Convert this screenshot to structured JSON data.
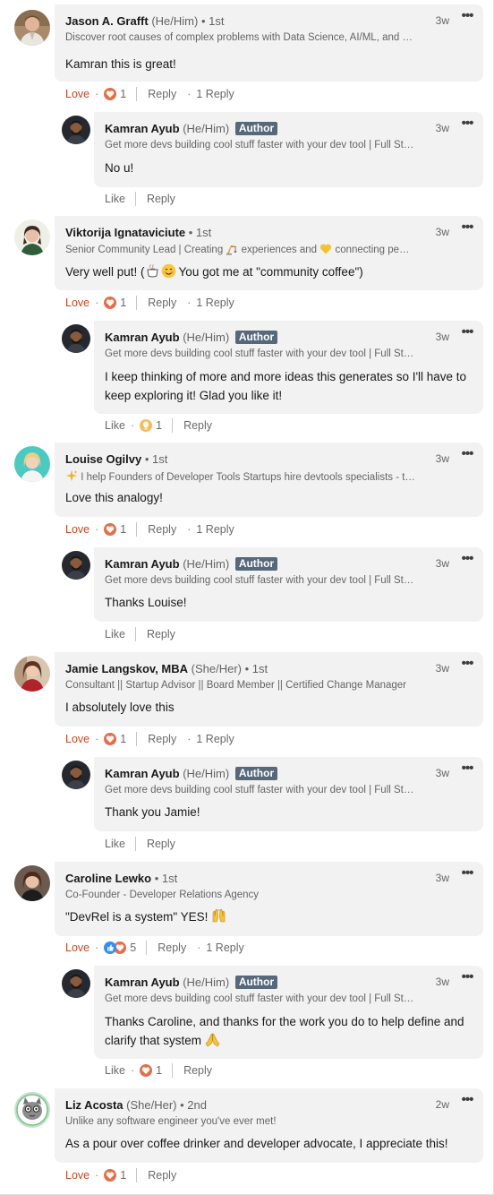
{
  "author_badge": "Author",
  "action_labels": {
    "reply": "Reply",
    "like": "Like"
  },
  "colors": {
    "love": "#c34a27",
    "bubble": "#f2f2f2",
    "badge": "#56687a"
  },
  "comments": [
    {
      "name": "Jason A. Grafft",
      "pronouns": "(He/Him)",
      "degree": "• 1st",
      "headline": "Discover root causes of complex problems with Data Science, AI/ML, and …",
      "time": "3w",
      "text": "Kamran this is great!",
      "reaction_label": "Love",
      "reaction_count": "1",
      "reply_count": "1 Reply",
      "reply": {
        "name": "Kamran Ayub",
        "pronouns": "(He/Him)",
        "headline": "Get more devs building cool stuff faster with your dev tool | Full St…",
        "time": "3w",
        "text": "No u!"
      }
    },
    {
      "name": "Viktorija Ignataviciute",
      "degree": "• 1st",
      "headline_parts": [
        "Senior Community Lead | Creating",
        "experiences and",
        "connecting pe…"
      ],
      "headline_icons": [
        "crane-icon",
        "yellow-heart-icon"
      ],
      "time": "3w",
      "text_parts": [
        "Very well put! (",
        "You got me at \"community coffee\")"
      ],
      "text_icons": [
        "coffee-icon",
        "smiling-face-icon"
      ],
      "reaction_label": "Love",
      "reaction_count": "1",
      "reply_count": "1 Reply",
      "reply": {
        "name": "Kamran Ayub",
        "pronouns": "(He/Him)",
        "headline": "Get more devs building cool stuff faster with your dev tool | Full St…",
        "time": "3w",
        "text": "I keep thinking of more and more ideas this generates so I'll have to keep exploring it! Glad you like it!",
        "reaction_icon": "insightful-icon",
        "reaction_count": "1"
      }
    },
    {
      "name": "Louise Ogilvy",
      "degree": "• 1st",
      "headline": "I help Founders of Developer Tools Startups hire devtools specialists - t…",
      "headline_icon": "sparkle-icon",
      "time": "3w",
      "text": "Love this analogy!",
      "reaction_label": "Love",
      "reaction_count": "1",
      "reply_count": "1 Reply",
      "reply": {
        "name": "Kamran Ayub",
        "pronouns": "(He/Him)",
        "headline": "Get more devs building cool stuff faster with your dev tool | Full St…",
        "time": "3w",
        "text": "Thanks Louise!"
      }
    },
    {
      "name": "Jamie Langskov, MBA",
      "pronouns": "(She/Her)",
      "degree": "• 1st",
      "headline": "Consultant || Startup Advisor || Board Member || Certified Change Manager",
      "time": "3w",
      "text": "I absolutely love this",
      "reaction_label": "Love",
      "reaction_count": "1",
      "reply_count": "1 Reply",
      "reply": {
        "name": "Kamran Ayub",
        "pronouns": "(He/Him)",
        "headline": "Get more devs building cool stuff faster with your dev tool | Full St…",
        "time": "3w",
        "text": "Thank you Jamie!"
      }
    },
    {
      "name": "Caroline Lewko",
      "degree": "• 1st",
      "headline": "Co-Founder - Developer Relations Agency",
      "time": "3w",
      "text": "\"DevRel is a system\" YES!",
      "text_icon": "raising-hands-icon",
      "reaction_label": "Love",
      "reaction_count": "5",
      "reply_count": "1 Reply",
      "reply": {
        "name": "Kamran Ayub",
        "pronouns": "(He/Him)",
        "headline": "Get more devs building cool stuff faster with your dev tool | Full St…",
        "time": "3w",
        "text": "Thanks Caroline, and thanks for the work you do to help define and clarify that system",
        "text_icon": "folded-hands-icon",
        "reaction_icon": "love-icon",
        "reaction_count": "1"
      }
    },
    {
      "name": "Liz Acosta",
      "pronouns": "(She/Her)",
      "degree": "• 2nd",
      "headline": "Unlike any software engineer you've ever met!",
      "time": "2w",
      "text": "As a pour over coffee drinker and developer advocate, I appreciate this!",
      "reaction_label": "Love",
      "reaction_count": "1"
    }
  ]
}
